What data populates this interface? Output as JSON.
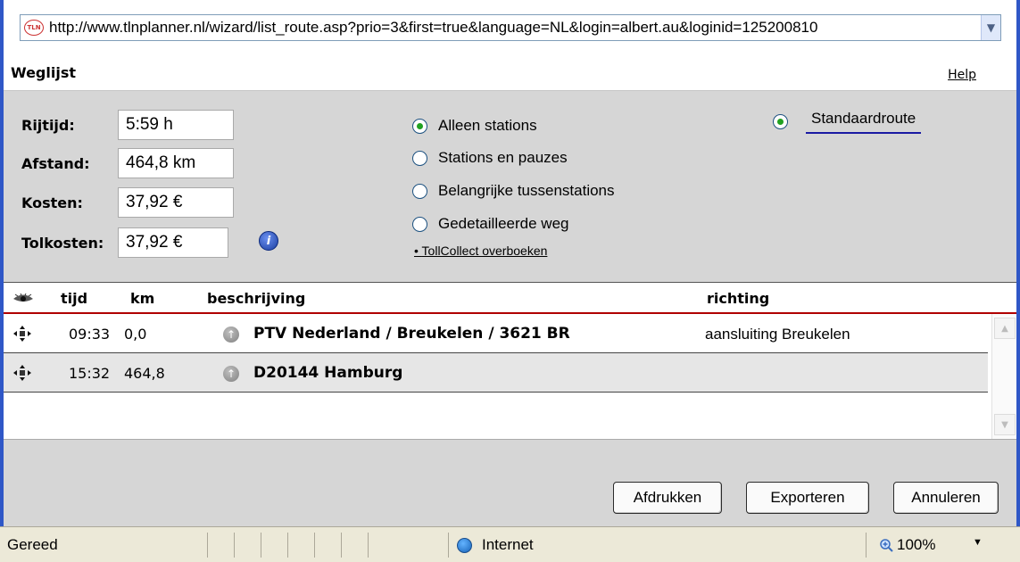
{
  "browser": {
    "url": "http://www.tlnplanner.nl/wizard/list_route.asp?prio=3&first=true&language=NL&login=albert.au&loginid=125200810",
    "site_icon_text": "TLN"
  },
  "header": {
    "title": "Weglijst",
    "help_link": "Help"
  },
  "summary": {
    "rijtijd_label": "Rijtijd:",
    "rijtijd_value": "5:59 h",
    "afstand_label": "Afstand:",
    "afstand_value": "464,8 km",
    "kosten_label": "Kosten:",
    "kosten_value": "37,92 €",
    "tolkosten_label": "Tolkosten:",
    "tolkosten_value": "37,92 €"
  },
  "detail_options": [
    {
      "label": "Alleen stations",
      "selected": true
    },
    {
      "label": "Stations en pauzes",
      "selected": false
    },
    {
      "label": "Belangrijke tussenstations",
      "selected": false
    },
    {
      "label": "Gedetailleerde weg",
      "selected": false
    }
  ],
  "tollcollect_link": "TollCollect overboeken",
  "route_option": {
    "label": "Standaardroute",
    "selected": true
  },
  "table": {
    "columns": {
      "tijd": "tijd",
      "km": "km",
      "beschrijving": "beschrijving",
      "richting": "richting"
    },
    "rows": [
      {
        "tijd": "09:33",
        "km": "0,0",
        "beschrijving": "PTV Nederland / Breukelen / 3621 BR",
        "richting": "aansluiting Breukelen"
      },
      {
        "tijd": "15:32",
        "km": "464,8",
        "beschrijving": "D20144 Hamburg",
        "richting": ""
      }
    ]
  },
  "buttons": {
    "print": "Afdrukken",
    "export": "Exporteren",
    "cancel": "Annuleren"
  },
  "statusbar": {
    "status": "Gereed",
    "zone": "Internet",
    "zoom": "100%"
  },
  "colors": {
    "window_border": "#2f57c7",
    "panel": "#d6d6d6",
    "header_rule": "#b00000",
    "radio_dot": "#21a121"
  }
}
